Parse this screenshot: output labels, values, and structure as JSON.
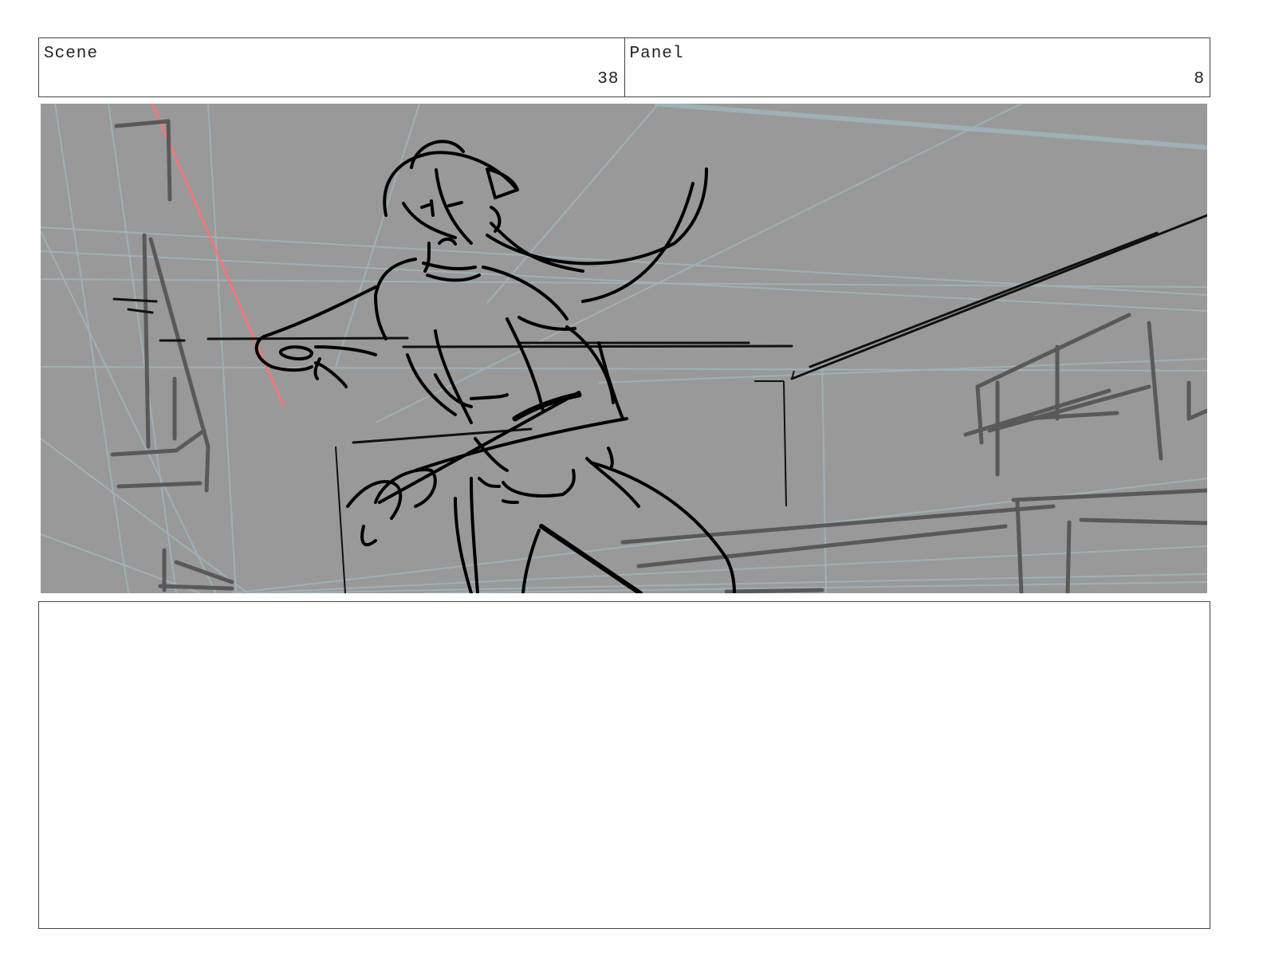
{
  "header": {
    "scene_label": "Scene",
    "scene_number": "38",
    "panel_label": "Panel",
    "panel_number": "8"
  },
  "frame": {
    "background_color": "#999999",
    "perspective_line_color": "#9fb4bd",
    "sketch_line_color": "#000000",
    "background_sketch_color": "#595959",
    "accent_line_color": "#f07878"
  },
  "notes": {
    "text": ""
  }
}
